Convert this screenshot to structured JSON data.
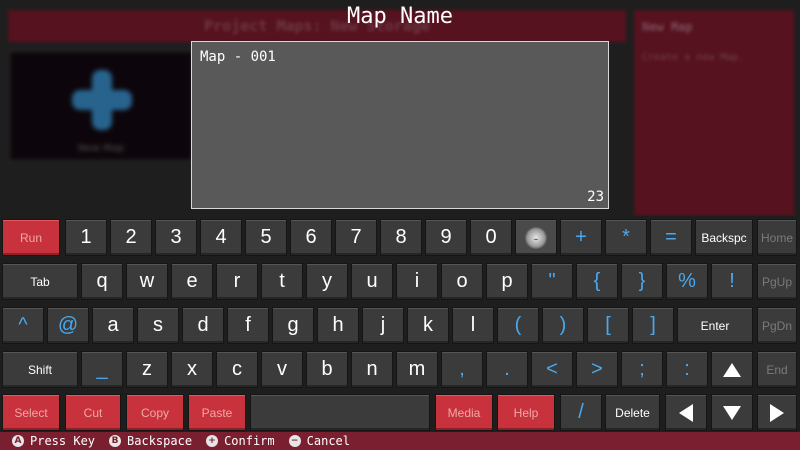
{
  "background": {
    "title": "Project Maps: New Storage",
    "card_label": "New Map",
    "side_title": "New Map",
    "side_description": "Create a new Map."
  },
  "dialog": {
    "title": "Map Name",
    "value": "Map - 001",
    "char_count": "23"
  },
  "keys": {
    "run": "Run",
    "k1": "1",
    "k2": "2",
    "k3": "3",
    "k4": "4",
    "k5": "5",
    "k6": "6",
    "k7": "7",
    "k8": "8",
    "k9": "9",
    "k0": "0",
    "minus": "-",
    "plus": "+",
    "star": "*",
    "equals": "=",
    "backspc": "Backspc",
    "home": "Home",
    "tab": "Tab",
    "q": "q",
    "w": "w",
    "e": "e",
    "r": "r",
    "t": "t",
    "y": "y",
    "u": "u",
    "i": "i",
    "o": "o",
    "p": "p",
    "quote": "\"",
    "lbrace": "{",
    "rbrace": "}",
    "percent": "%",
    "excl": "!",
    "pgup": "PgUp",
    "caret": "^",
    "at": "@",
    "a": "a",
    "s": "s",
    "d": "d",
    "f": "f",
    "g": "g",
    "h": "h",
    "j": "j",
    "k": "k",
    "l": "l",
    "lparen": "(",
    "rparen": ")",
    "lbracket": "[",
    "rbracket": "]",
    "enter": "Enter",
    "pgdn": "PgDn",
    "shift": "Shift",
    "underscore": "_",
    "z": "z",
    "x": "x",
    "c": "c",
    "v": "v",
    "b": "b",
    "n": "n",
    "m": "m",
    "comma": ",",
    "period": ".",
    "lt": "<",
    "gt": ">",
    "semicolon": ";",
    "colon": ":",
    "end": "End",
    "select": "Select",
    "cut": "Cut",
    "copy": "Copy",
    "paste": "Paste",
    "space": "",
    "media": "Media",
    "help": "Help",
    "slash": "/",
    "delete": "Delete"
  },
  "footer": {
    "hints": [
      {
        "button": "A",
        "label": "Press Key"
      },
      {
        "button": "B",
        "label": "Backspace"
      },
      {
        "button": "+",
        "label": "Confirm"
      },
      {
        "button": "−",
        "label": "Cancel"
      }
    ]
  },
  "colors": {
    "accent_red": "#c8323c",
    "footer_bg": "#7a1f30",
    "symbol_blue": "#4aa9ee"
  }
}
